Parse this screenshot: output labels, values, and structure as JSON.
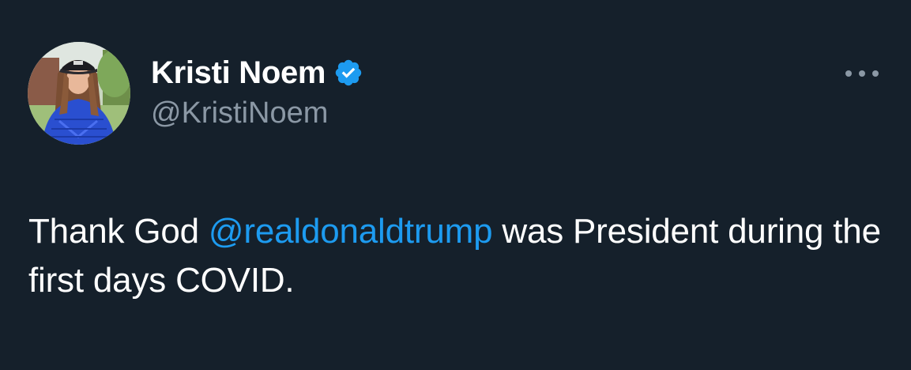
{
  "author": {
    "display_name": "Kristi Noem",
    "handle": "@KristiNoem",
    "verified": true,
    "avatar_icon": "profile-photo"
  },
  "tweet": {
    "text_before": "Thank God ",
    "mention": "@realdonaldtrump",
    "text_after": " was President during the first days COVID."
  },
  "menu": {
    "icon": "more-horizontal-icon"
  },
  "colors": {
    "background": "#15202b",
    "text": "#ffffff",
    "secondary_text": "#8b98a5",
    "accent": "#1d9bf0"
  }
}
